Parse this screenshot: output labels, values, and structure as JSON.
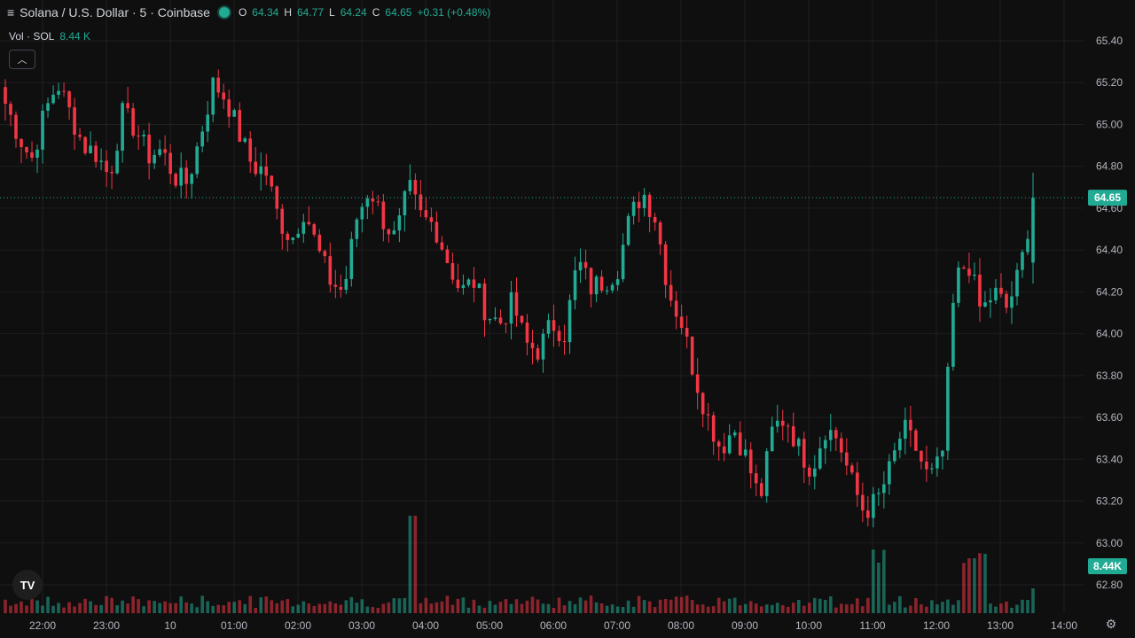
{
  "header": {
    "symbol_icon": "menu-lines-icon",
    "title": "Solana / U.S. Dollar · 5 · Coinbase",
    "open_label": "O",
    "open": "64.34",
    "high_label": "H",
    "high": "64.77",
    "low_label": "L",
    "low": "64.24",
    "close_label": "C",
    "close": "64.65",
    "change": "+0.31 (+0.48%)",
    "volume_label": "Vol · SOL",
    "volume_value": "8.44 K"
  },
  "controls": {
    "collapse_icon": "chevron-up-icon",
    "settings_icon": "gear-icon",
    "logo_text": "TV"
  },
  "colors": {
    "up": "#22ab94",
    "down": "#f23645",
    "background": "#0f0f0f",
    "grid": "#1f1f1f",
    "text": "#d1d4dc"
  },
  "chart_data": {
    "type": "candlestick",
    "title": "Solana / U.S. Dollar · 5 · Coinbase",
    "price_axis_ticks": [
      "65.40",
      "65.20",
      "65.00",
      "64.80",
      "64.60",
      "64.40",
      "64.20",
      "64.00",
      "63.80",
      "63.60",
      "63.40",
      "63.20",
      "63.00",
      "62.80"
    ],
    "ylim": [
      62.72,
      65.54
    ],
    "time_axis_ticks": [
      "22:00",
      "23:00",
      "10",
      "01:00",
      "02:00",
      "03:00",
      "04:00",
      "05:00",
      "06:00",
      "07:00",
      "08:00",
      "09:00",
      "10:00",
      "11:00",
      "12:00",
      "13:00",
      "14:00"
    ],
    "last_price": "64.65",
    "last_volume": "8.44K",
    "bar_count": 194,
    "anchor_closes": [
      65.1,
      64.95,
      64.83,
      65.05,
      65.2,
      65.05,
      64.9,
      64.86,
      64.75,
      65.05,
      64.98,
      64.85,
      64.88,
      64.75,
      64.72,
      64.95,
      65.2,
      65.12,
      64.95,
      64.8,
      64.78,
      64.55,
      64.45,
      64.6,
      64.4,
      64.25,
      64.2,
      64.55,
      64.7,
      64.55,
      64.45,
      64.7,
      64.55,
      64.52,
      64.35,
      64.2,
      64.25,
      64.1,
      64.05,
      64.15,
      63.95,
      63.92,
      64.05,
      64.0,
      64.35,
      64.22,
      64.25,
      64.3,
      64.55,
      64.68,
      64.55,
      64.2,
      64.05,
      63.8,
      63.6,
      63.45,
      63.55,
      63.4,
      63.2,
      63.55,
      63.6,
      63.45,
      63.35,
      63.55,
      63.5,
      63.3,
      63.15,
      63.2,
      63.35,
      63.55,
      63.45,
      63.3,
      63.4,
      64.25,
      64.35,
      64.1,
      64.2,
      64.12,
      64.3,
      64.65
    ],
    "volumes_relative": "low baseline with spikes near 04:00, 11:00 and 12:30"
  }
}
